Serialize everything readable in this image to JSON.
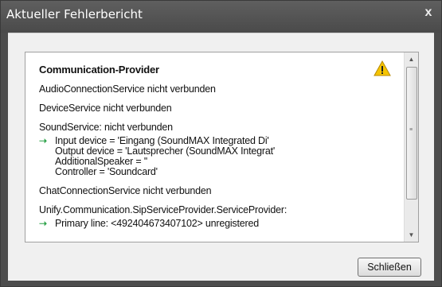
{
  "window": {
    "title": "Aktueller Fehlerbericht",
    "close_label": "x"
  },
  "report": {
    "heading": "Communication-Provider",
    "lines": [
      "AudioConnectionService nicht verbunden",
      "DeviceService nicht verbunden",
      "SoundService: nicht verbunden",
      "Input device = 'Eingang (SoundMAX Integrated Di'",
      "Output device = 'Lautsprecher (SoundMAX Integrat'",
      "AdditionalSpeaker = ''",
      "Controller = 'Soundcard'",
      "ChatConnectionService nicht verbunden",
      "Unify.Communication.SipServiceProvider.ServiceProvider:",
      "Primary line: <492404673407102> unregistered"
    ]
  },
  "icons": {
    "warning": "warning-icon",
    "arrow": "green-arrow-icon",
    "scroll_up": "scroll-up-icon",
    "scroll_down": "scroll-down-icon"
  },
  "colors": {
    "arrow": "#2ea34a",
    "warning": "#f5c400",
    "titlebar": "#555555"
  },
  "buttons": {
    "close": "Schließen"
  }
}
